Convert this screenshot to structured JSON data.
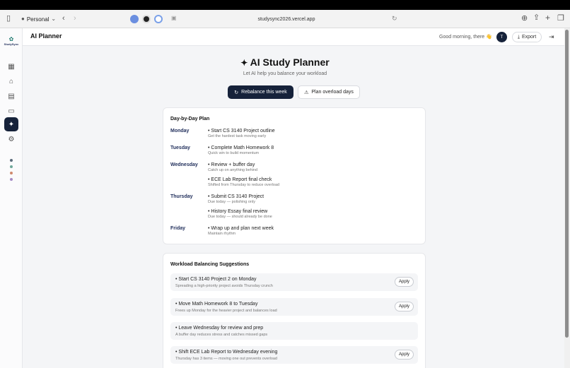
{
  "browser": {
    "profile_label": "Personal",
    "url": "studysync2026.vercel.app"
  },
  "app": {
    "brand": "StudySync",
    "page_title": "AI Planner",
    "greeting": "Good morning, there 👋",
    "avatar_initial": "T",
    "export_label": "Export"
  },
  "sidebar": {
    "items": [
      {
        "name": "calendar",
        "glyph": "▦"
      },
      {
        "name": "home",
        "glyph": "⌂"
      },
      {
        "name": "clipboard",
        "glyph": "▤"
      },
      {
        "name": "book",
        "glyph": "▭"
      },
      {
        "name": "ai-planner",
        "glyph": "✦"
      },
      {
        "name": "settings",
        "glyph": "⚙"
      }
    ],
    "dot_colors": [
      "#5b6b7a",
      "#6fa89a",
      "#d08a6e",
      "#a58bc4"
    ]
  },
  "hero": {
    "title": "AI Study Planner",
    "subtitle": "Let AI help you balance your workload",
    "rebalance_label": "Rebalance this week",
    "overload_label": "Plan overload days"
  },
  "plan": {
    "title": "Day-by-Day Plan",
    "days": [
      {
        "day": "Monday",
        "tasks": [
          {
            "title": "• Start CS 3140 Project outline",
            "note": "Get the hardest task moving early"
          }
        ]
      },
      {
        "day": "Tuesday",
        "tasks": [
          {
            "title": "• Complete Math Homework 8",
            "note": "Quick win to build momentum"
          }
        ]
      },
      {
        "day": "Wednesday",
        "tasks": [
          {
            "title": "• Review + buffer day",
            "note": "Catch up on anything behind"
          },
          {
            "title": "• ECE Lab Report final check",
            "note": "Shifted from Thursday to reduce overload"
          }
        ]
      },
      {
        "day": "Thursday",
        "tasks": [
          {
            "title": "• Submit CS 3140 Project",
            "note": "Due today — polishing only"
          },
          {
            "title": "• History Essay final review",
            "note": "Due today — should already be done"
          }
        ]
      },
      {
        "day": "Friday",
        "tasks": [
          {
            "title": "• Wrap up and plan next week",
            "note": "Maintain rhythm"
          }
        ]
      }
    ]
  },
  "suggestions": {
    "title": "Workload Balancing Suggestions",
    "apply_label": "Apply",
    "items": [
      {
        "title": "• Start CS 3140 Project 2 on Monday",
        "note": "Spreading a high-priority project avoids Thursday crunch",
        "has_apply": true
      },
      {
        "title": "• Move Math Homework 8 to Tuesday",
        "note": "Frees up Monday for the heavier project and balances load",
        "has_apply": true
      },
      {
        "title": "• Leave Wednesday for review and prep",
        "note": "A buffer day reduces stress and catches missed gaps",
        "has_apply": false
      },
      {
        "title": "• Shift ECE Lab Report to Wednesday evening",
        "note": "Thursday has 3 items — moving one out prevents overload",
        "has_apply": true
      }
    ]
  },
  "colors": {
    "navy": "#16223a",
    "accent_text": "#1f2d5a"
  }
}
